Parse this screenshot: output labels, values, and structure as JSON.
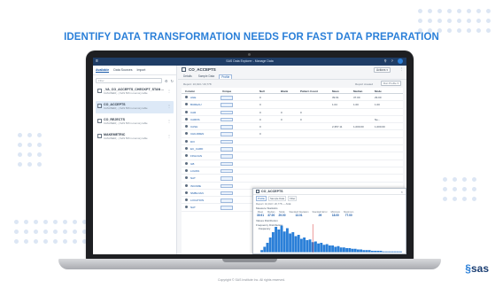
{
  "slide": {
    "title": "IDENTIFY DATA TRANSFORMATION NEEDS FOR FAST DATA PREPARATION",
    "copyright": "Copyright © SAS Institute Inc. All rights reserved.",
    "logo_text": "sas",
    "accent_color": "#2a7fd8"
  },
  "app": {
    "title": "SAS Data Explorer - Manage Data",
    "left_tabs": [
      "Available",
      "Data Sources",
      "Import"
    ],
    "search_placeholder": "Filter",
    "datasets": [
      {
        "name": "_VA_CO_ACCEPTS_CHECKPT_STAN ...",
        "sub": "CASUSER(...) SAS 5/8 in-memory table",
        "selected": false
      },
      {
        "name": "CO_ACCEPTS",
        "sub": "CASUSER(...) SAS 5/8 in-memory table",
        "selected": true
      },
      {
        "name": "CO_REJECTS",
        "sub": "CASUSER(...) SAS 5/8 in-memory table",
        "selected": false
      },
      {
        "name": "MAKEMETRIC",
        "sub": "CASUSER(...) SAS 5/8 in-memory table",
        "selected": false
      }
    ]
  },
  "main": {
    "dataset_name": "CO_ACCEPTS",
    "actions_label": "Actions ▾",
    "tabs": [
      "Details",
      "Sample Data",
      "Profile"
    ],
    "active_tab": "Profile",
    "rows_text": "Report: 10,913 / 20,778",
    "report_text": "Report created",
    "run_label": "Run Profile ▾",
    "columns": [
      "Column",
      "Unique",
      "Null",
      "Blank",
      "Pattern Count",
      "Mean",
      "Median",
      "Mode"
    ],
    "rows": [
      {
        "col": "AGE",
        "null": "0",
        "blank": "",
        "pattern": "",
        "mean": "39.91",
        "median": "37.00",
        "mode": "29.00"
      },
      {
        "col": "BUREAU",
        "null": "0",
        "blank": "",
        "pattern": "",
        "mean": "1.04",
        "median": "1.00",
        "mode": "1.00"
      },
      {
        "col": "CAR",
        "null": "0",
        "blank": "0",
        "pattern": "0",
        "mean": "",
        "median": "",
        "mode": ""
      },
      {
        "col": "CARDS",
        "null": "0",
        "blank": "0",
        "pattern": "0",
        "mean": "",
        "median": "",
        "mode": "Ne..."
      },
      {
        "col": "CASH",
        "null": "0",
        "blank": "",
        "pattern": "",
        "mean": "2,357.11",
        "median": "1,000.00",
        "mode": "1,000.00"
      },
      {
        "col": "CHILDREN",
        "null": "0",
        "blank": "",
        "pattern": "",
        "mean": "",
        "median": "",
        "mode": ""
      },
      {
        "col": "DIV",
        "null": "",
        "blank": "",
        "pattern": "",
        "mean": "",
        "median": "",
        "mode": ""
      },
      {
        "col": "EC_CARD",
        "null": "",
        "blank": "",
        "pattern": "",
        "mean": "",
        "median": "",
        "mode": ""
      },
      {
        "col": "FINLOAN",
        "null": "",
        "blank": "",
        "pattern": "",
        "mean": "",
        "median": "",
        "mode": ""
      },
      {
        "col": "GB",
        "null": "",
        "blank": "",
        "pattern": "",
        "mean": "",
        "median": "",
        "mode": ""
      },
      {
        "col": "LOANS",
        "null": "",
        "blank": "",
        "pattern": "",
        "mean": "",
        "median": "",
        "mode": ""
      },
      {
        "col": "NAT",
        "null": "",
        "blank": "",
        "pattern": "",
        "mean": "",
        "median": "",
        "mode": ""
      },
      {
        "col": "INCOME",
        "null": "",
        "blank": "",
        "pattern": "",
        "mean": "",
        "median": "",
        "mode": ""
      },
      {
        "col": "NMBLOAN",
        "null": "",
        "blank": "",
        "pattern": "",
        "mean": "",
        "median": "",
        "mode": ""
      },
      {
        "col": "LOCATION",
        "null": "",
        "blank": "",
        "pattern": "",
        "mean": "",
        "median": "",
        "mode": ""
      },
      {
        "col": "NAT",
        "null": "",
        "blank": "",
        "pattern": "",
        "mean": "",
        "median": "",
        "mode": ""
      }
    ]
  },
  "popup": {
    "name": "CO_ACCEPTS",
    "tabs": [
      "Profile",
      "Sample Data",
      "Filter"
    ],
    "sub": "Report: 10,913 / 20,778 — AGE",
    "section1": "Measure Statistics",
    "stats": [
      {
        "label": "Mean",
        "value": "39.91"
      },
      {
        "label": "Median",
        "value": "37.00"
      },
      {
        "label": "Mode",
        "value": "29.00"
      },
      {
        "label": "Standard Deviation",
        "value": "13.01"
      },
      {
        "label": "Standard Error",
        "value": ".09"
      },
      {
        "label": "Minimum",
        "value": "18.00"
      },
      {
        "label": "Maximum",
        "value": "77.00"
      }
    ],
    "section2": "Values Distribution",
    "section3": "Frequency Distribution",
    "chart_title": "Frequency"
  },
  "chart_data": {
    "type": "bar",
    "title": "Frequency",
    "values": [
      3,
      8,
      14,
      22,
      30,
      38,
      34,
      40,
      31,
      36,
      28,
      30,
      24,
      26,
      20,
      22,
      18,
      19,
      15,
      16,
      13,
      14,
      11,
      12,
      10,
      10,
      8,
      9,
      7,
      7,
      6,
      6,
      5,
      5,
      4,
      4,
      3,
      3,
      3,
      2,
      2,
      2,
      2,
      1,
      1,
      1,
      1,
      1,
      1,
      1
    ],
    "marker_index": 18,
    "bar_color": "#2a7fd8",
    "marker_color": "#d9383a"
  }
}
